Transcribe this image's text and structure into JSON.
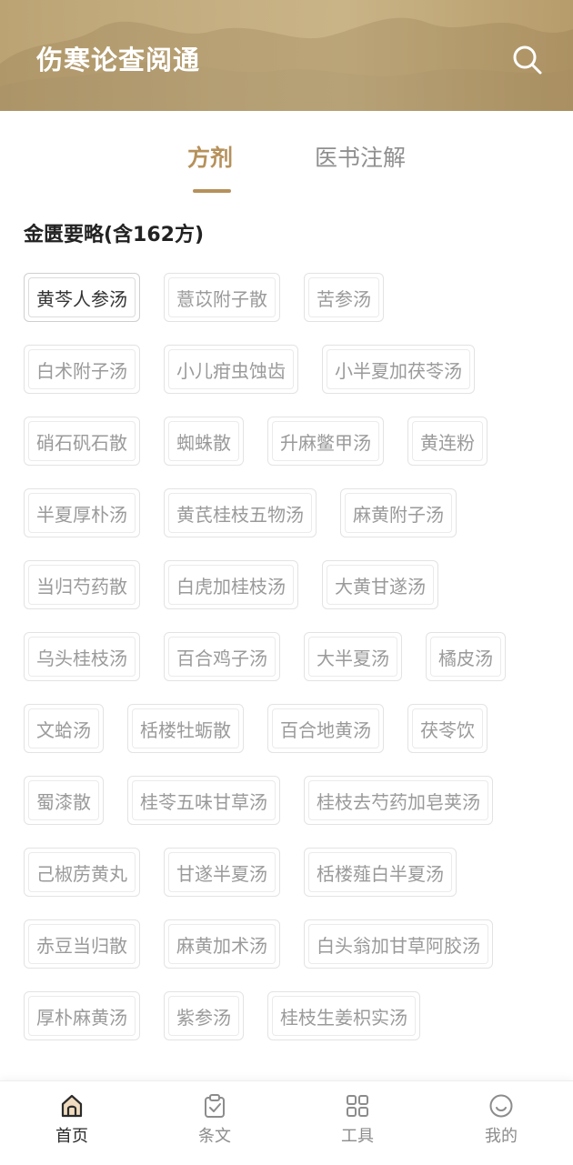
{
  "app": {
    "title": "伤寒论查阅通"
  },
  "tabs": [
    {
      "label": "方剂",
      "active": true
    },
    {
      "label": "医书注解",
      "active": false
    }
  ],
  "section": {
    "title": "金匮要略(含162方)"
  },
  "formula_rows": [
    [
      "黄芩人参汤",
      "薏苡附子散",
      "苦参汤"
    ],
    [
      "白术附子汤",
      "小儿疳虫蚀齿",
      "小半夏加茯苓汤"
    ],
    [
      "硝石矾石散",
      "蜘蛛散",
      "升麻鳖甲汤",
      "黄连粉"
    ],
    [
      "半夏厚朴汤",
      "黄芪桂枝五物汤",
      "麻黄附子汤"
    ],
    [
      "当归芍药散",
      "白虎加桂枝汤",
      "大黄甘遂汤"
    ],
    [
      "乌头桂枝汤",
      "百合鸡子汤",
      "大半夏汤",
      "橘皮汤"
    ],
    [
      "文蛤汤",
      "栝楼牡蛎散",
      "百合地黄汤",
      "茯苓饮"
    ],
    [
      "蜀漆散",
      "桂苓五味甘草汤",
      "桂枝去芍药加皂荚汤"
    ],
    [
      "己椒苈黄丸",
      "甘遂半夏汤",
      "栝楼薤白半夏汤"
    ],
    [
      "赤豆当归散",
      "麻黄加术汤",
      "白头翁加甘草阿胶汤"
    ],
    [
      "厚朴麻黄汤",
      "紫参汤",
      "桂枝生姜枳实汤"
    ]
  ],
  "bottom_nav": [
    {
      "label": "首页",
      "icon": "home-icon",
      "active": true
    },
    {
      "label": "条文",
      "icon": "clipboard-check-icon",
      "active": false
    },
    {
      "label": "工具",
      "icon": "grid-icon",
      "active": false
    },
    {
      "label": "我的",
      "icon": "smile-icon",
      "active": false
    }
  ],
  "colors": {
    "header": "#c2aa7c",
    "accent": "#b6915b",
    "chip_text": "#9a9a9a",
    "nav_inactive": "#8c8c8c"
  }
}
